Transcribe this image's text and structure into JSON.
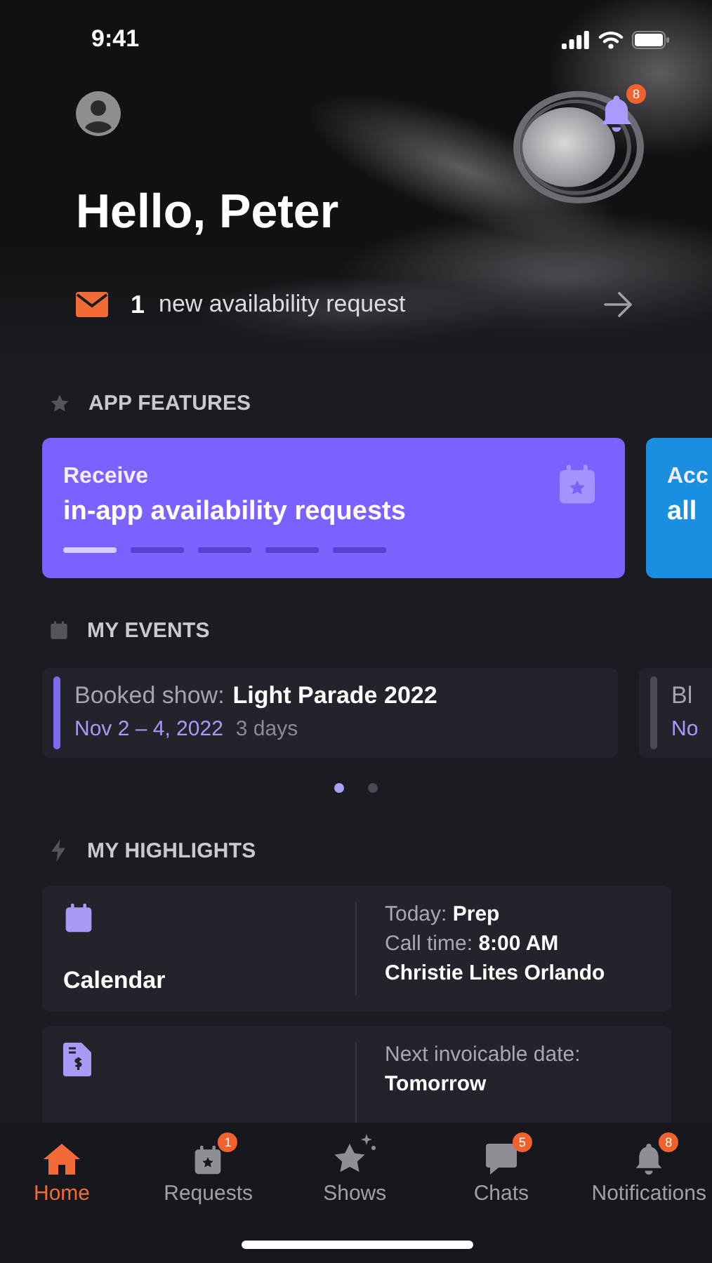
{
  "status_bar": {
    "time": "9:41"
  },
  "header": {
    "notification_badge": "8",
    "greeting": "Hello, Peter",
    "request_banner": {
      "count": "1",
      "text": "new availability request"
    }
  },
  "app_features": {
    "title": "APP FEATURES",
    "cards": [
      {
        "line1": "Receive",
        "line2": "in-app availability requests",
        "color": "#7b61ff",
        "pager": [
          {
            "selected": true
          },
          {
            "selected": false
          },
          {
            "selected": false
          },
          {
            "selected": false
          },
          {
            "selected": false
          }
        ]
      },
      {
        "line1": "Acc",
        "line2": "all",
        "color": "#1a8fe0"
      }
    ]
  },
  "my_events": {
    "title": "MY EVENTS",
    "events": [
      {
        "label": "Booked show:",
        "name": "Light Parade 2022",
        "dates": "Nov 2 – 4, 2022",
        "duration": "3 days",
        "color": "#7b6cf0"
      },
      {
        "label": "Bl",
        "dates": "No",
        "color": "#4a4b52"
      }
    ],
    "pages": [
      {
        "selected": true
      },
      {
        "selected": false
      }
    ]
  },
  "my_highlights": {
    "title": "MY HIGHLIGHTS",
    "cards": [
      {
        "kind": "calendar",
        "title": "Calendar",
        "lines": [
          {
            "text": "Today: **Prep**",
            "strong": false
          },
          {
            "text": "Call time: **8:00 AM**",
            "strong": false
          },
          {
            "text": "Christie Lites Orlando",
            "strong": true
          }
        ]
      },
      {
        "kind": "invoice",
        "lines": [
          {
            "text": "Next invoicable date:",
            "strong": false
          },
          {
            "text": "Tomorrow",
            "strong": true
          }
        ]
      }
    ]
  },
  "tab_bar": [
    {
      "kind": "home",
      "label": "Home",
      "selected": true
    },
    {
      "kind": "requests",
      "label": "Requests",
      "badge": "1",
      "selected": false
    },
    {
      "kind": "shows",
      "label": "Shows",
      "selected": false
    },
    {
      "kind": "chats",
      "label": "Chats",
      "badge": "5",
      "selected": false
    },
    {
      "kind": "notifications",
      "label": "Notifications",
      "badge": "8",
      "selected": false
    }
  ]
}
